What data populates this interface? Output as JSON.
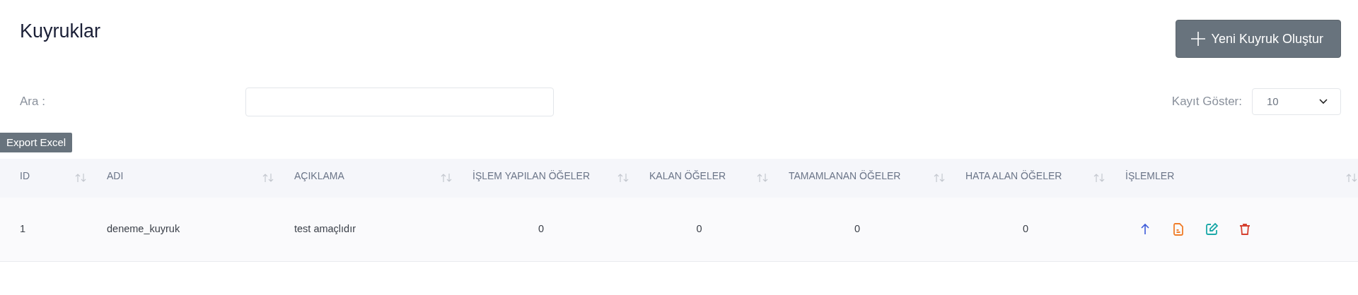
{
  "page": {
    "title": "Kuyruklar"
  },
  "create_button": {
    "label": "Yeni Kuyruk Oluştur"
  },
  "search": {
    "label": "Ara :"
  },
  "page_size": {
    "label": "Kayıt Göster:",
    "value": "10"
  },
  "export_button": {
    "label": "Export Excel"
  },
  "table": {
    "columns": [
      {
        "label": "ID",
        "kind": "text"
      },
      {
        "label": "ADI",
        "kind": "text"
      },
      {
        "label": "AÇIKLAMA",
        "kind": "text"
      },
      {
        "label": "İŞLEM YAPILAN ÖĞELER",
        "kind": "count"
      },
      {
        "label": "KALAN ÖĞELER",
        "kind": "count"
      },
      {
        "label": "TAMAMLANAN ÖĞELER",
        "kind": "count"
      },
      {
        "label": "HATA ALAN ÖĞELER",
        "kind": "count"
      },
      {
        "label": "İŞLEMLER",
        "kind": "actions"
      }
    ],
    "rows": [
      {
        "cells": [
          "1",
          "deneme_kuyruk",
          "test amaçlıdır",
          "0",
          "0",
          "0",
          "0"
        ],
        "actions": [
          {
            "kind": "up"
          },
          {
            "kind": "document"
          },
          {
            "kind": "edit"
          },
          {
            "kind": "delete"
          }
        ]
      }
    ]
  }
}
